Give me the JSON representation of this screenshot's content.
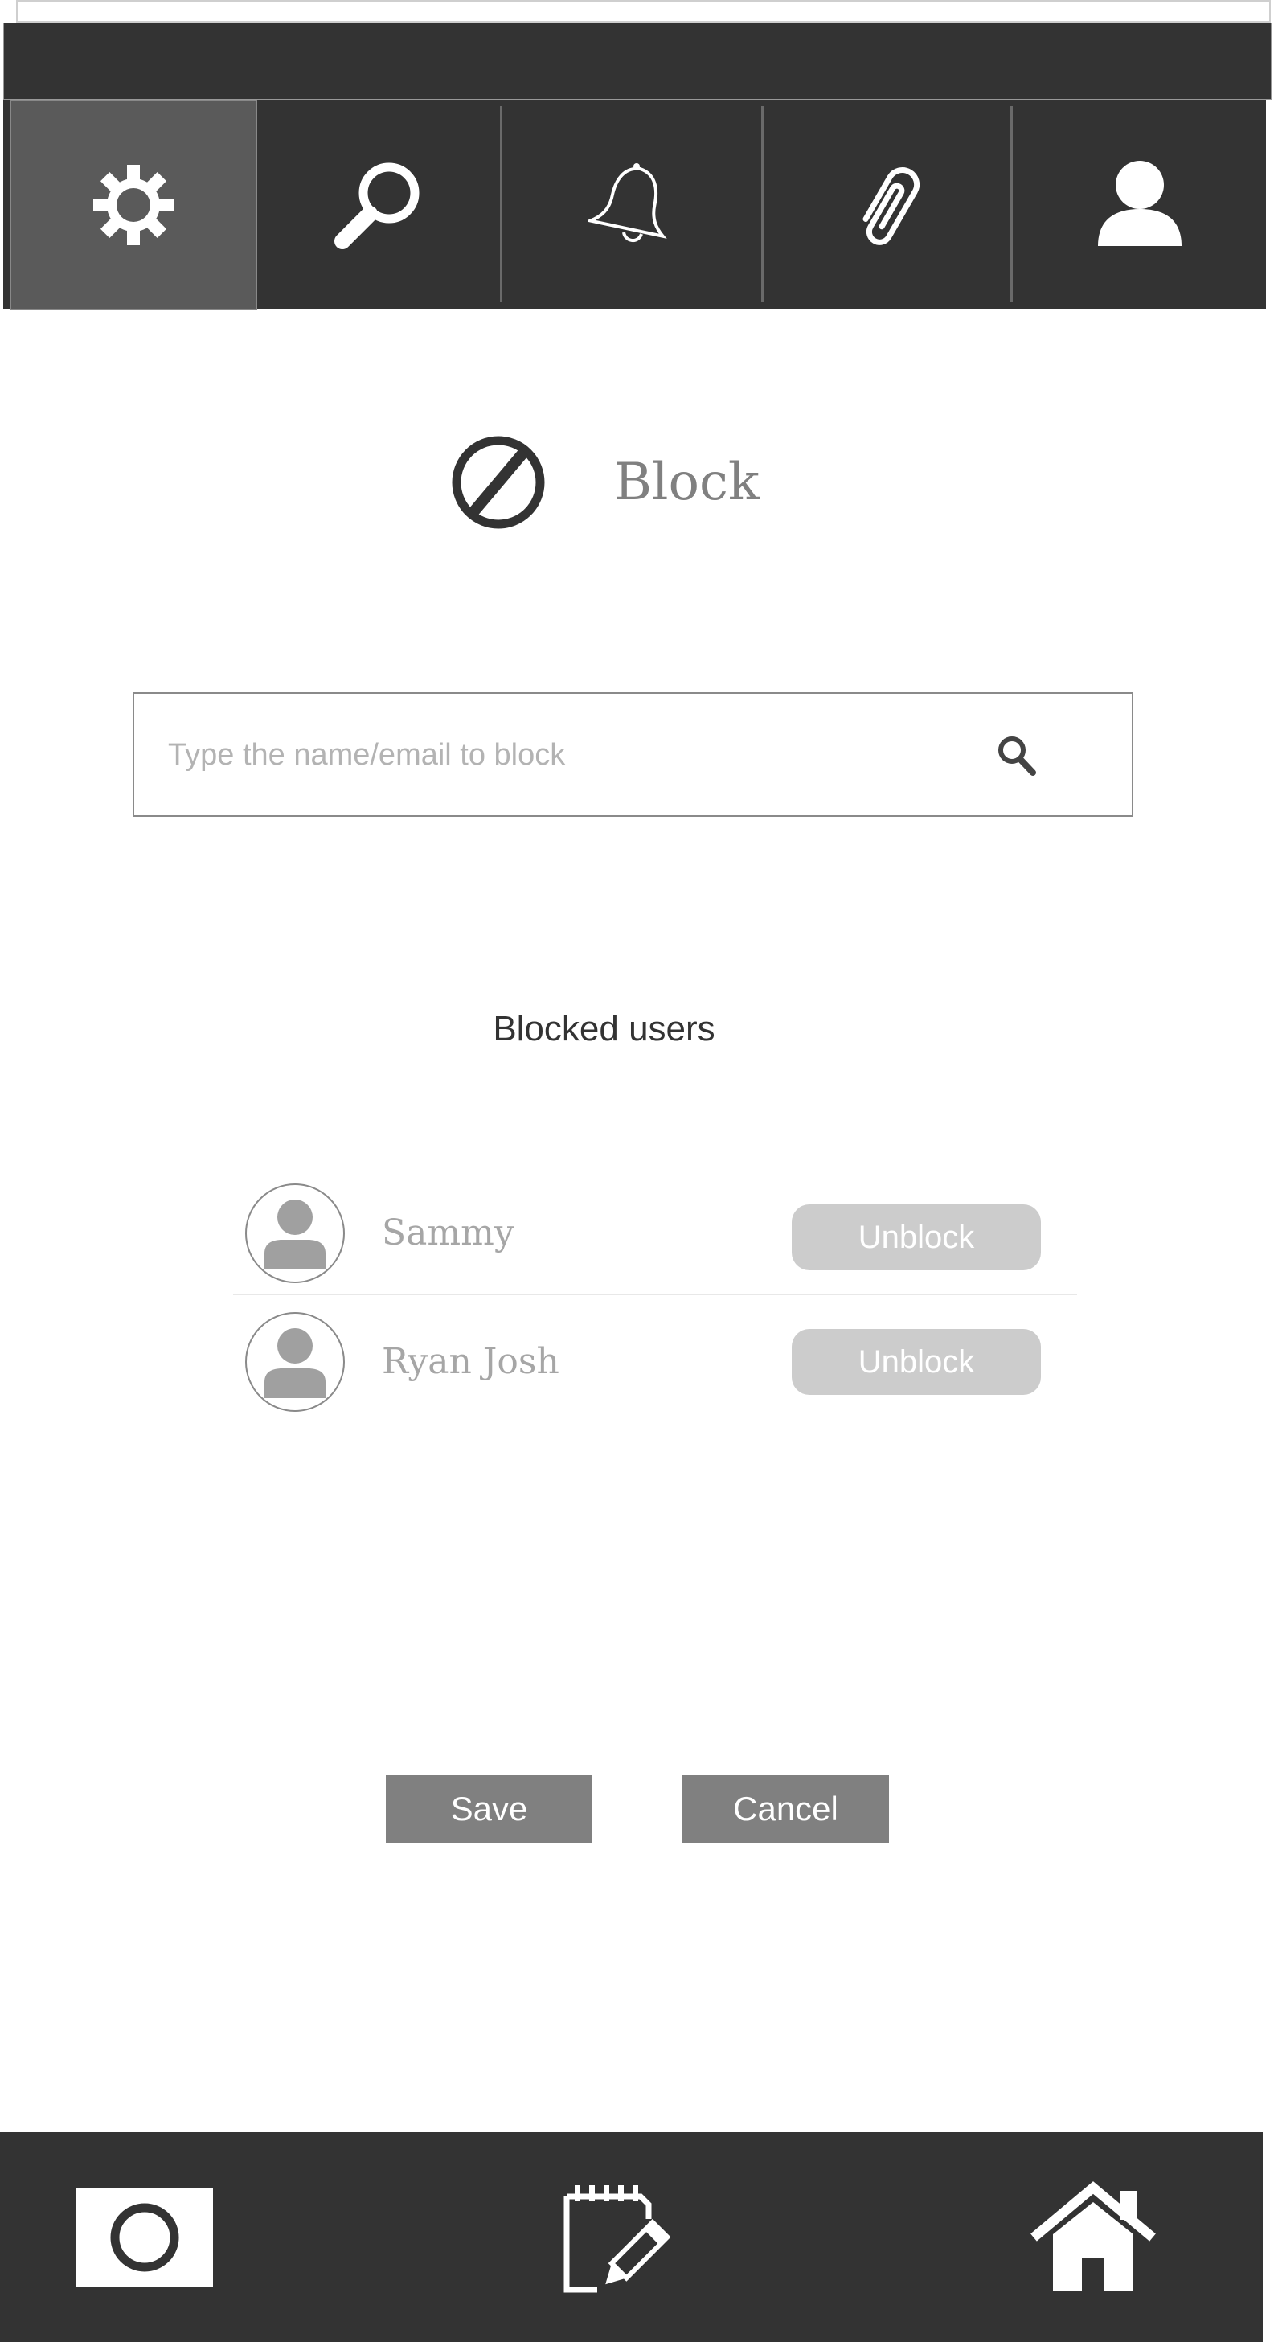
{
  "tabs": [
    {
      "name": "settings",
      "icon": "gear-icon",
      "active": true
    },
    {
      "name": "search",
      "icon": "magnifier-icon",
      "active": false
    },
    {
      "name": "notifications",
      "icon": "bell-icon",
      "active": false
    },
    {
      "name": "attachments",
      "icon": "paperclip-icon",
      "active": false
    },
    {
      "name": "profile",
      "icon": "user-icon",
      "active": false
    }
  ],
  "header": {
    "title": "Block",
    "icon": "block-icon"
  },
  "search": {
    "placeholder": "Type the name/email to block",
    "icon": "search-icon"
  },
  "blocked": {
    "title": "Blocked users",
    "users": [
      {
        "name": "Sammy",
        "action": "Unblock"
      },
      {
        "name": "Ryan Josh",
        "action": "Unblock"
      }
    ]
  },
  "actions": {
    "save": "Save",
    "cancel": "Cancel"
  },
  "bottom_nav": [
    {
      "name": "camera",
      "icon": "camera-icon"
    },
    {
      "name": "notes",
      "icon": "notepad-edit-icon"
    },
    {
      "name": "home",
      "icon": "home-icon"
    }
  ],
  "colors": {
    "bar": "#333333",
    "active_tab": "#5a5a5a",
    "button": "#808080",
    "unblock": "#cccccc"
  }
}
